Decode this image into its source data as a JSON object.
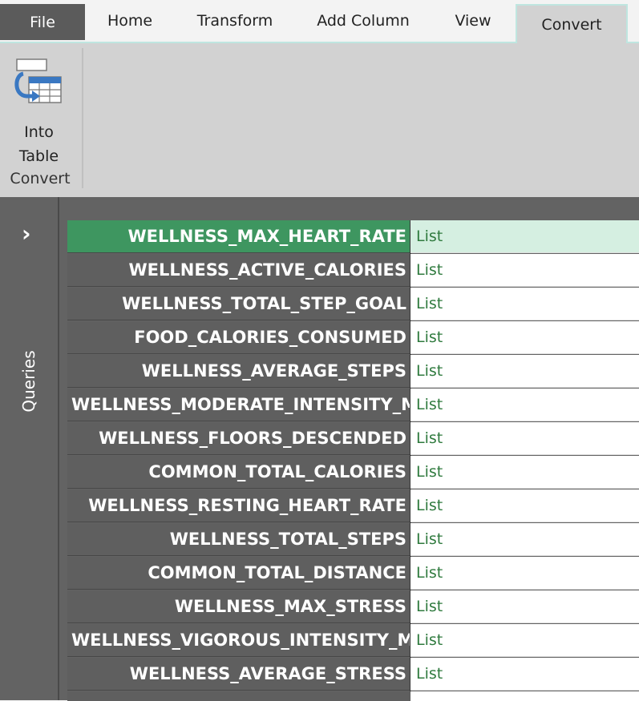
{
  "tabs": {
    "file": "File",
    "home": "Home",
    "transform": "Transform",
    "add_column": "Add Column",
    "view": "View",
    "convert": "Convert"
  },
  "ribbon": {
    "into_table_line1": "Into",
    "into_table_line2": "Table",
    "group_label": "Convert",
    "icon": "into-table-icon"
  },
  "queries_pane": {
    "label": "Queries",
    "expand_icon": "chevron-right-icon"
  },
  "record": {
    "rows": [
      {
        "key": "WELLNESS_MAX_HEART_RATE",
        "value": "List"
      },
      {
        "key": "WELLNESS_ACTIVE_CALORIES",
        "value": "List"
      },
      {
        "key": "WELLNESS_TOTAL_STEP_GOAL",
        "value": "List"
      },
      {
        "key": "FOOD_CALORIES_CONSUMED",
        "value": "List"
      },
      {
        "key": "WELLNESS_AVERAGE_STEPS",
        "value": "List"
      },
      {
        "key": "WELLNESS_MODERATE_INTENSITY_M",
        "value": "List"
      },
      {
        "key": "WELLNESS_FLOORS_DESCENDED",
        "value": "List"
      },
      {
        "key": "COMMON_TOTAL_CALORIES",
        "value": "List"
      },
      {
        "key": "WELLNESS_RESTING_HEART_RATE",
        "value": "List"
      },
      {
        "key": "WELLNESS_TOTAL_STEPS",
        "value": "List"
      },
      {
        "key": "COMMON_TOTAL_DISTANCE",
        "value": "List"
      },
      {
        "key": "WELLNESS_MAX_STRESS",
        "value": "List"
      },
      {
        "key": "WELLNESS_VIGOROUS_INTENSITY_MI",
        "value": "List"
      },
      {
        "key": "WELLNESS_AVERAGE_STRESS",
        "value": "List"
      }
    ]
  },
  "colors": {
    "selected_key_bg": "#3e9660",
    "selected_value_bg": "#d5efe1",
    "value_text": "#2f7a3e",
    "key_bg": "#5f5f5f"
  }
}
